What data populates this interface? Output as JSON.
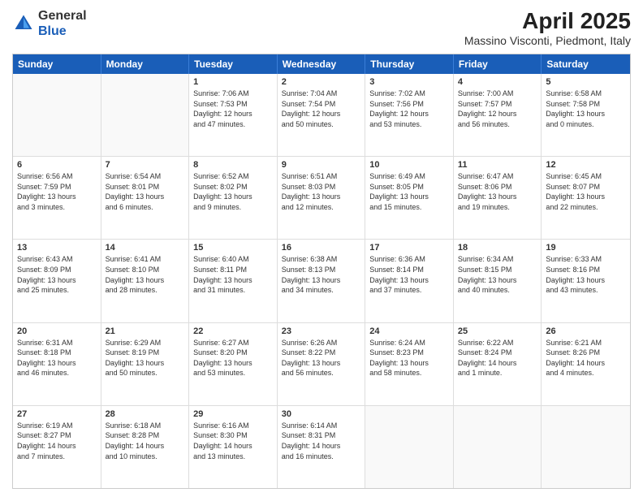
{
  "header": {
    "logo_general": "General",
    "logo_blue": "Blue",
    "title": "April 2025",
    "subtitle": "Massino Visconti, Piedmont, Italy"
  },
  "weekdays": [
    "Sunday",
    "Monday",
    "Tuesday",
    "Wednesday",
    "Thursday",
    "Friday",
    "Saturday"
  ],
  "weeks": [
    [
      {
        "day": "",
        "empty": true,
        "text": ""
      },
      {
        "day": "",
        "empty": true,
        "text": ""
      },
      {
        "day": "1",
        "empty": false,
        "text": "Sunrise: 7:06 AM\nSunset: 7:53 PM\nDaylight: 12 hours\nand 47 minutes."
      },
      {
        "day": "2",
        "empty": false,
        "text": "Sunrise: 7:04 AM\nSunset: 7:54 PM\nDaylight: 12 hours\nand 50 minutes."
      },
      {
        "day": "3",
        "empty": false,
        "text": "Sunrise: 7:02 AM\nSunset: 7:56 PM\nDaylight: 12 hours\nand 53 minutes."
      },
      {
        "day": "4",
        "empty": false,
        "text": "Sunrise: 7:00 AM\nSunset: 7:57 PM\nDaylight: 12 hours\nand 56 minutes."
      },
      {
        "day": "5",
        "empty": false,
        "text": "Sunrise: 6:58 AM\nSunset: 7:58 PM\nDaylight: 13 hours\nand 0 minutes."
      }
    ],
    [
      {
        "day": "6",
        "empty": false,
        "text": "Sunrise: 6:56 AM\nSunset: 7:59 PM\nDaylight: 13 hours\nand 3 minutes."
      },
      {
        "day": "7",
        "empty": false,
        "text": "Sunrise: 6:54 AM\nSunset: 8:01 PM\nDaylight: 13 hours\nand 6 minutes."
      },
      {
        "day": "8",
        "empty": false,
        "text": "Sunrise: 6:52 AM\nSunset: 8:02 PM\nDaylight: 13 hours\nand 9 minutes."
      },
      {
        "day": "9",
        "empty": false,
        "text": "Sunrise: 6:51 AM\nSunset: 8:03 PM\nDaylight: 13 hours\nand 12 minutes."
      },
      {
        "day": "10",
        "empty": false,
        "text": "Sunrise: 6:49 AM\nSunset: 8:05 PM\nDaylight: 13 hours\nand 15 minutes."
      },
      {
        "day": "11",
        "empty": false,
        "text": "Sunrise: 6:47 AM\nSunset: 8:06 PM\nDaylight: 13 hours\nand 19 minutes."
      },
      {
        "day": "12",
        "empty": false,
        "text": "Sunrise: 6:45 AM\nSunset: 8:07 PM\nDaylight: 13 hours\nand 22 minutes."
      }
    ],
    [
      {
        "day": "13",
        "empty": false,
        "text": "Sunrise: 6:43 AM\nSunset: 8:09 PM\nDaylight: 13 hours\nand 25 minutes."
      },
      {
        "day": "14",
        "empty": false,
        "text": "Sunrise: 6:41 AM\nSunset: 8:10 PM\nDaylight: 13 hours\nand 28 minutes."
      },
      {
        "day": "15",
        "empty": false,
        "text": "Sunrise: 6:40 AM\nSunset: 8:11 PM\nDaylight: 13 hours\nand 31 minutes."
      },
      {
        "day": "16",
        "empty": false,
        "text": "Sunrise: 6:38 AM\nSunset: 8:13 PM\nDaylight: 13 hours\nand 34 minutes."
      },
      {
        "day": "17",
        "empty": false,
        "text": "Sunrise: 6:36 AM\nSunset: 8:14 PM\nDaylight: 13 hours\nand 37 minutes."
      },
      {
        "day": "18",
        "empty": false,
        "text": "Sunrise: 6:34 AM\nSunset: 8:15 PM\nDaylight: 13 hours\nand 40 minutes."
      },
      {
        "day": "19",
        "empty": false,
        "text": "Sunrise: 6:33 AM\nSunset: 8:16 PM\nDaylight: 13 hours\nand 43 minutes."
      }
    ],
    [
      {
        "day": "20",
        "empty": false,
        "text": "Sunrise: 6:31 AM\nSunset: 8:18 PM\nDaylight: 13 hours\nand 46 minutes."
      },
      {
        "day": "21",
        "empty": false,
        "text": "Sunrise: 6:29 AM\nSunset: 8:19 PM\nDaylight: 13 hours\nand 50 minutes."
      },
      {
        "day": "22",
        "empty": false,
        "text": "Sunrise: 6:27 AM\nSunset: 8:20 PM\nDaylight: 13 hours\nand 53 minutes."
      },
      {
        "day": "23",
        "empty": false,
        "text": "Sunrise: 6:26 AM\nSunset: 8:22 PM\nDaylight: 13 hours\nand 56 minutes."
      },
      {
        "day": "24",
        "empty": false,
        "text": "Sunrise: 6:24 AM\nSunset: 8:23 PM\nDaylight: 13 hours\nand 58 minutes."
      },
      {
        "day": "25",
        "empty": false,
        "text": "Sunrise: 6:22 AM\nSunset: 8:24 PM\nDaylight: 14 hours\nand 1 minute."
      },
      {
        "day": "26",
        "empty": false,
        "text": "Sunrise: 6:21 AM\nSunset: 8:26 PM\nDaylight: 14 hours\nand 4 minutes."
      }
    ],
    [
      {
        "day": "27",
        "empty": false,
        "text": "Sunrise: 6:19 AM\nSunset: 8:27 PM\nDaylight: 14 hours\nand 7 minutes."
      },
      {
        "day": "28",
        "empty": false,
        "text": "Sunrise: 6:18 AM\nSunset: 8:28 PM\nDaylight: 14 hours\nand 10 minutes."
      },
      {
        "day": "29",
        "empty": false,
        "text": "Sunrise: 6:16 AM\nSunset: 8:30 PM\nDaylight: 14 hours\nand 13 minutes."
      },
      {
        "day": "30",
        "empty": false,
        "text": "Sunrise: 6:14 AM\nSunset: 8:31 PM\nDaylight: 14 hours\nand 16 minutes."
      },
      {
        "day": "",
        "empty": true,
        "text": ""
      },
      {
        "day": "",
        "empty": true,
        "text": ""
      },
      {
        "day": "",
        "empty": true,
        "text": ""
      }
    ]
  ]
}
